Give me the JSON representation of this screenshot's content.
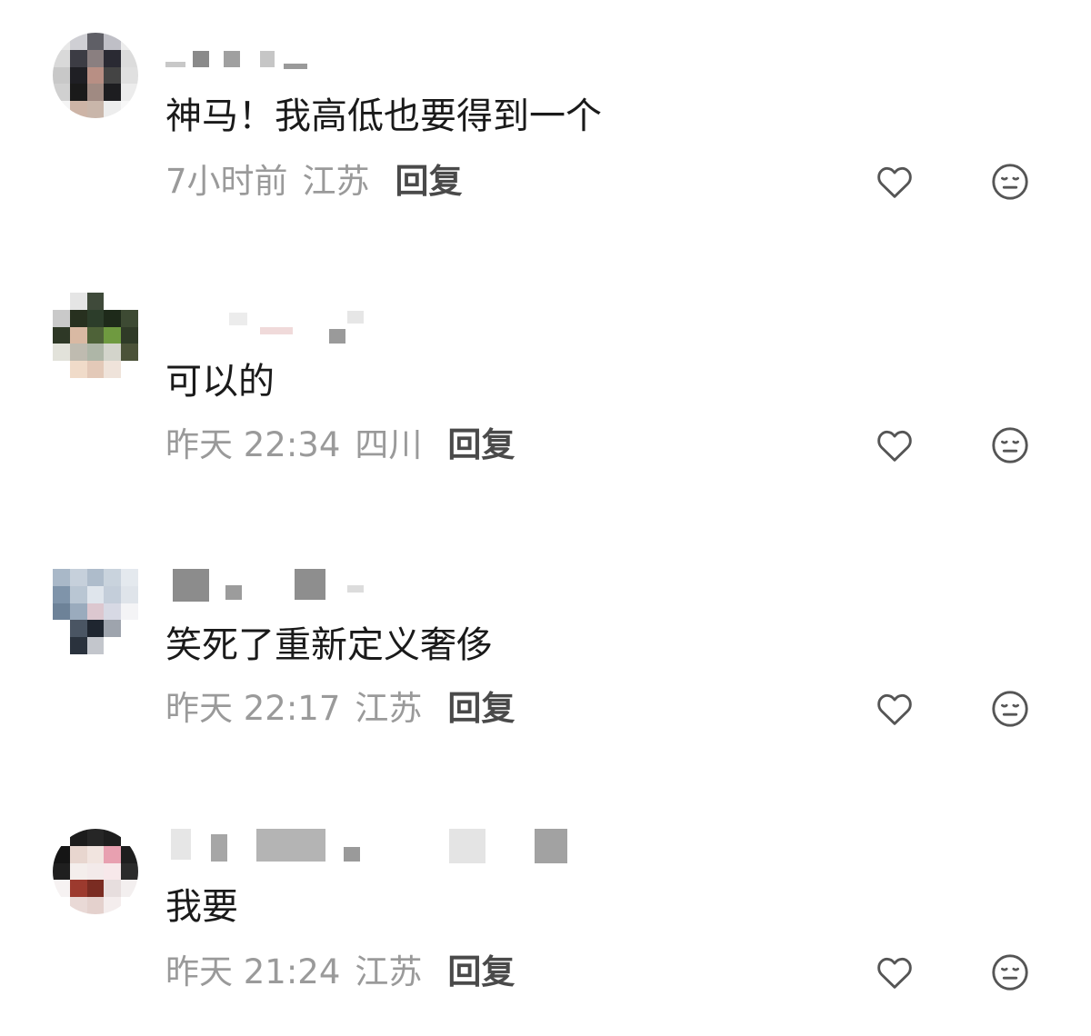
{
  "comments": [
    {
      "text": "神马！我高低也要得到一个",
      "time": "7小时前",
      "location": "江苏",
      "reply_label": "回复",
      "avatar": "avatar-icon"
    },
    {
      "text": "可以的",
      "time": "昨天 22:34",
      "location": "四川",
      "reply_label": "回复",
      "avatar": "avatar-icon"
    },
    {
      "text": "笑死了重新定义奢侈",
      "time": "昨天 22:17",
      "location": "江苏",
      "reply_label": "回复",
      "avatar": "avatar-icon"
    },
    {
      "text": "我要",
      "time": "昨天 21:24",
      "location": "江苏",
      "reply_label": "回复",
      "avatar": "avatar-icon"
    }
  ],
  "icons": {
    "like": "heart-icon",
    "reaction": "neutral-face-icon"
  },
  "colors": {
    "text": "#1a1a1a",
    "meta": "#9a9a9a",
    "reply": "#4a4a4a",
    "icon": "#555555"
  }
}
